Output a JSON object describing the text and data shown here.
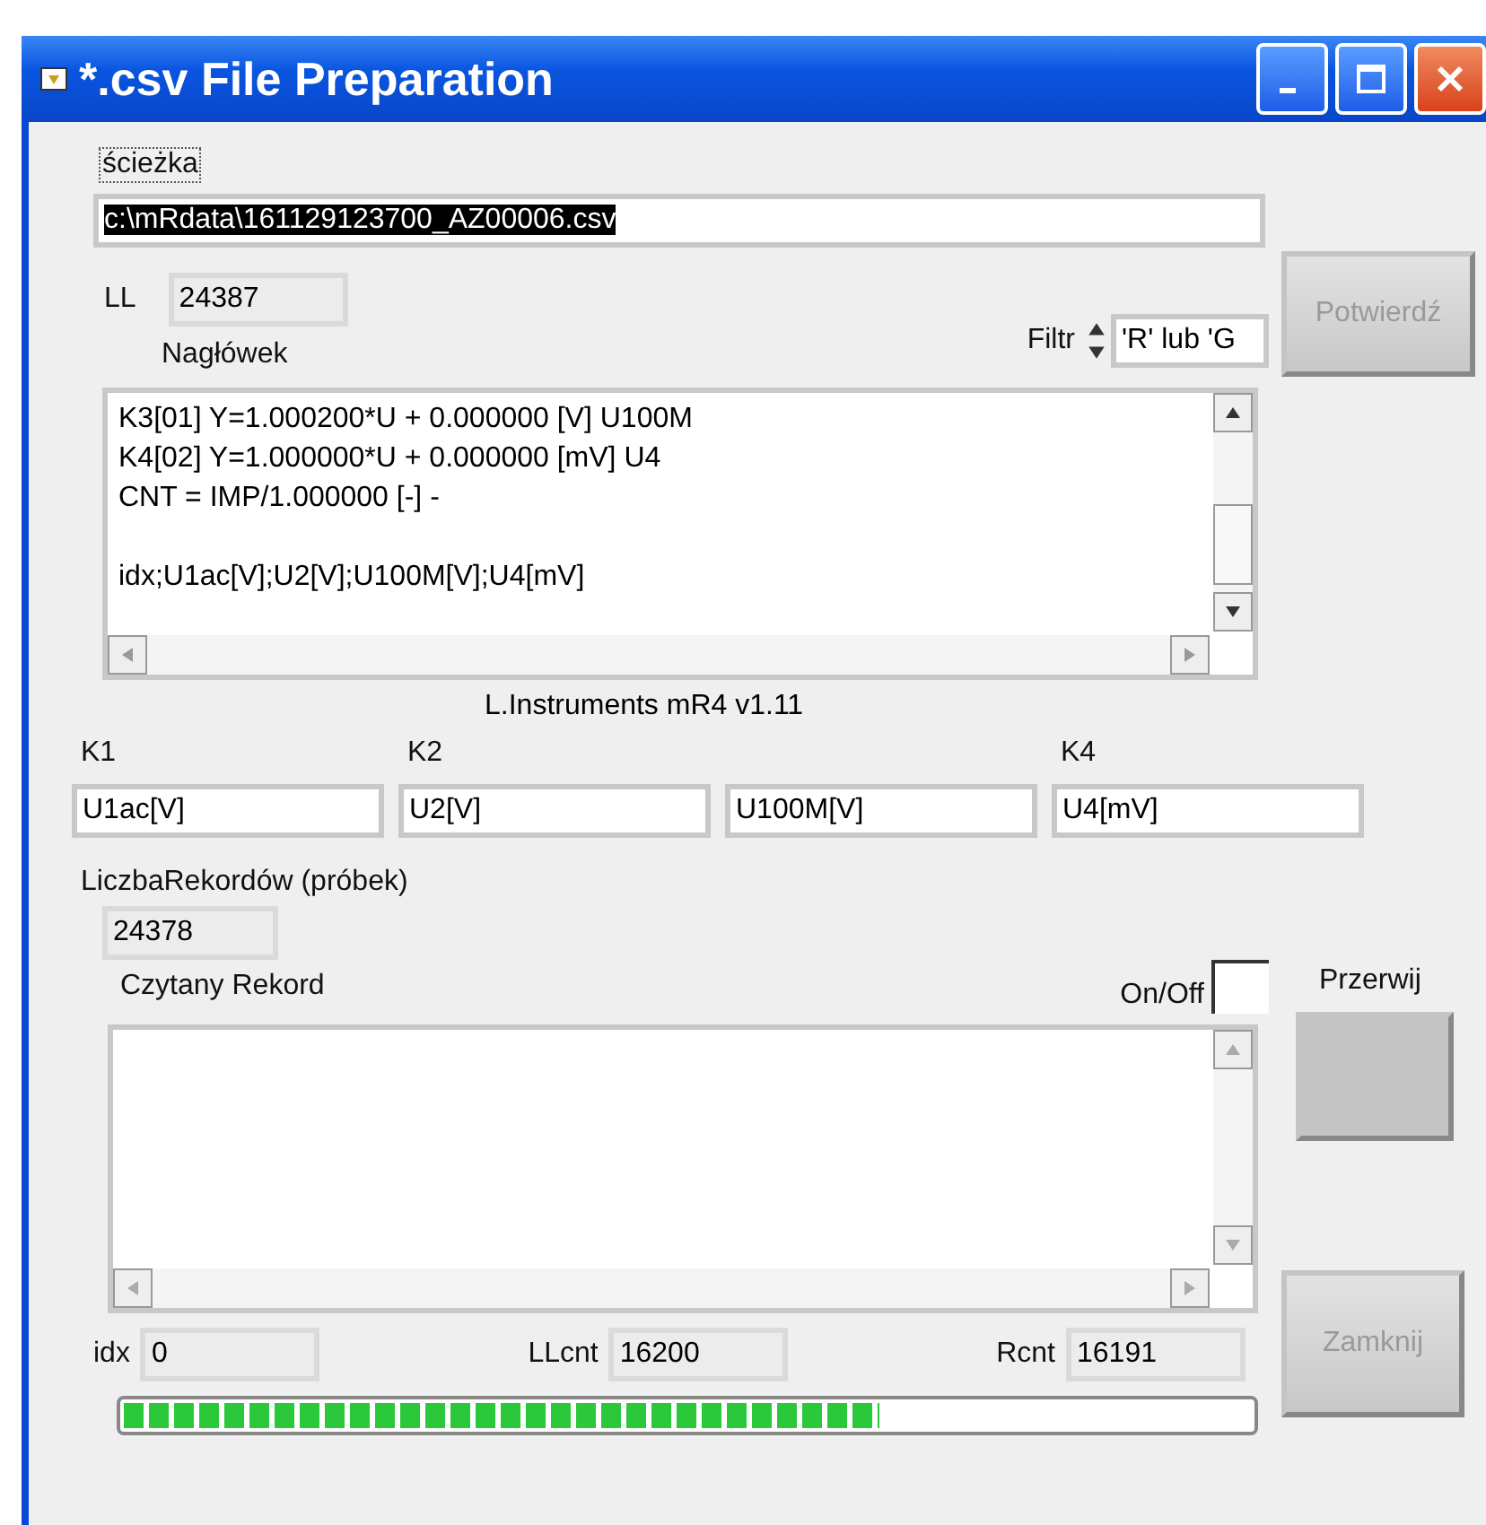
{
  "window": {
    "title": "*.csv File Preparation"
  },
  "path": {
    "label": "ścieżka",
    "value": "c:\\mRdata\\161129123700_AZ00006.csv",
    "selected": true
  },
  "ll": {
    "label": "LL",
    "value": "24387"
  },
  "header": {
    "label": "Nagłówek",
    "blocks": [
      [
        "K3[01] Y=1.000200*U + 0.000000 [V] U100M",
        "K4[02] Y=1.000000*U + 0.000000 [mV] U4",
        "CNT = IMP/1.000000 [-] -"
      ],
      [
        "idx;U1ac[V];U2[V];U100M[V];U4[mV]"
      ]
    ]
  },
  "filter": {
    "label": "Filtr",
    "value": "'R' lub 'G"
  },
  "confirm_button": {
    "label": "Potwierdź",
    "disabled": true
  },
  "version": "L.Instruments mR4 v1.11",
  "channels": [
    {
      "label": "K1",
      "value": "U1ac[V]"
    },
    {
      "label": "K2",
      "value": "U2[V]"
    },
    {
      "value": "U100M[V]"
    },
    {
      "label": "K4",
      "value": "U4[mV]"
    }
  ],
  "records": {
    "label": "LiczbaRekordów (próbek)",
    "value": "24378"
  },
  "current_record": {
    "label": "Czytany Rekord"
  },
  "on_off": {
    "label": "On/Off",
    "checked": false
  },
  "abort_button": {
    "label": "Przerwij"
  },
  "counters": [
    {
      "label": "idx",
      "value": "0"
    },
    {
      "label": "LLcnt",
      "value": "16200"
    },
    {
      "label": "Rcnt",
      "value": "16191"
    }
  ],
  "close_button": {
    "label": "Zamknij",
    "disabled": true
  },
  "progress": {
    "level": 0.67
  }
}
